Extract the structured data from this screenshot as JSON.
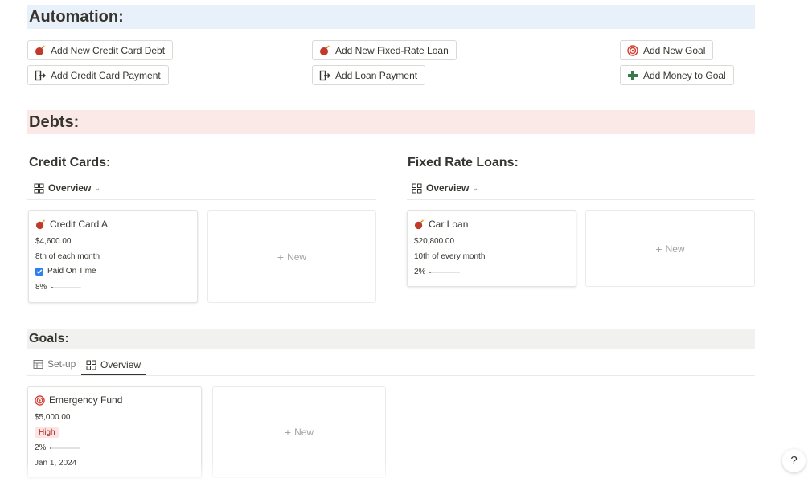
{
  "colors": {
    "automation_bg": "#e8f1f9",
    "debts_bg": "#fbe9e8",
    "goals_bg": "#f1f1ef",
    "bomb": "#c0392b",
    "plus": "#3a7a4a",
    "target": "#d63c2f"
  },
  "automation": {
    "heading": "Automation:",
    "buttons": {
      "add_cc_debt": {
        "label": "Add New Credit Card Debt",
        "icon": "bomb-icon"
      },
      "add_cc_payment": {
        "label": "Add Credit Card Payment",
        "icon": "exit-door-icon"
      },
      "add_loan": {
        "label": "Add New Fixed-Rate Loan",
        "icon": "bomb-icon"
      },
      "add_loan_payment": {
        "label": "Add Loan Payment",
        "icon": "exit-door-icon"
      },
      "add_goal": {
        "label": "Add New Goal",
        "icon": "target-icon"
      },
      "add_money_goal": {
        "label": "Add Money to Goal",
        "icon": "plus-icon"
      }
    }
  },
  "debts": {
    "heading": "Debts:",
    "credit_cards": {
      "heading": "Credit Cards:",
      "view": "Overview",
      "card": {
        "title": "Credit Card A",
        "amount": "$4,600.00",
        "due": "8th of each month",
        "paid_label": "Paid On Time",
        "paid": true,
        "progress_label": "8%",
        "progress": 0.08
      },
      "new_label": "New"
    },
    "loans": {
      "heading": "Fixed Rate Loans:",
      "view": "Overview",
      "card": {
        "title": "Car Loan",
        "amount": "$20,800.00",
        "due": "10th of every month",
        "progress_label": "2%",
        "progress": 0.02
      },
      "new_label": "New"
    }
  },
  "goals": {
    "heading": "Goals:",
    "tabs": [
      {
        "label": "Set-up",
        "icon": "table-icon"
      },
      {
        "label": "Overview",
        "icon": "gallery-icon"
      }
    ],
    "card": {
      "title": "Emergency Fund",
      "amount": "$5,000.00",
      "priority": "High",
      "progress_label": "2%",
      "progress": 0.02,
      "date": "Jan 1, 2024"
    },
    "new_label": "New"
  },
  "help": "?"
}
